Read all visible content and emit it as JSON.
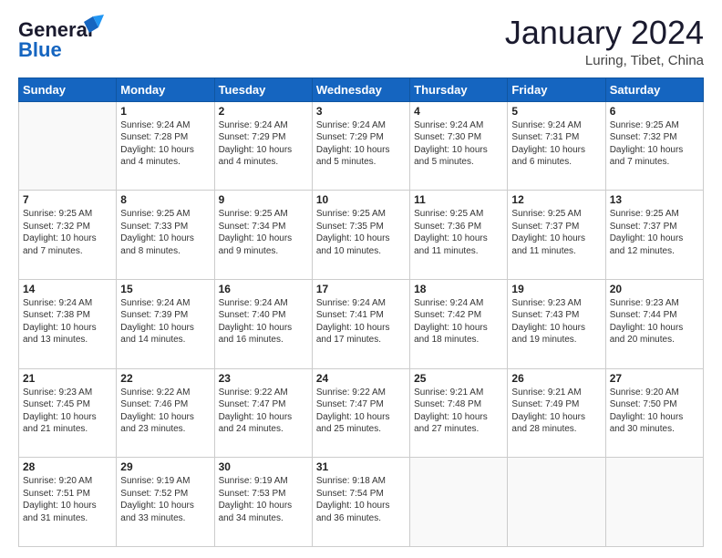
{
  "header": {
    "logo_line1": "General",
    "logo_line2": "Blue",
    "month_year": "January 2024",
    "location": "Luring, Tibet, China"
  },
  "days_of_week": [
    "Sunday",
    "Monday",
    "Tuesday",
    "Wednesday",
    "Thursday",
    "Friday",
    "Saturday"
  ],
  "weeks": [
    [
      {
        "day": "",
        "content": ""
      },
      {
        "day": "1",
        "content": "Sunrise: 9:24 AM\nSunset: 7:28 PM\nDaylight: 10 hours\nand 4 minutes."
      },
      {
        "day": "2",
        "content": "Sunrise: 9:24 AM\nSunset: 7:29 PM\nDaylight: 10 hours\nand 4 minutes."
      },
      {
        "day": "3",
        "content": "Sunrise: 9:24 AM\nSunset: 7:29 PM\nDaylight: 10 hours\nand 5 minutes."
      },
      {
        "day": "4",
        "content": "Sunrise: 9:24 AM\nSunset: 7:30 PM\nDaylight: 10 hours\nand 5 minutes."
      },
      {
        "day": "5",
        "content": "Sunrise: 9:24 AM\nSunset: 7:31 PM\nDaylight: 10 hours\nand 6 minutes."
      },
      {
        "day": "6",
        "content": "Sunrise: 9:25 AM\nSunset: 7:32 PM\nDaylight: 10 hours\nand 7 minutes."
      }
    ],
    [
      {
        "day": "7",
        "content": "Sunrise: 9:25 AM\nSunset: 7:32 PM\nDaylight: 10 hours\nand 7 minutes."
      },
      {
        "day": "8",
        "content": "Sunrise: 9:25 AM\nSunset: 7:33 PM\nDaylight: 10 hours\nand 8 minutes."
      },
      {
        "day": "9",
        "content": "Sunrise: 9:25 AM\nSunset: 7:34 PM\nDaylight: 10 hours\nand 9 minutes."
      },
      {
        "day": "10",
        "content": "Sunrise: 9:25 AM\nSunset: 7:35 PM\nDaylight: 10 hours\nand 10 minutes."
      },
      {
        "day": "11",
        "content": "Sunrise: 9:25 AM\nSunset: 7:36 PM\nDaylight: 10 hours\nand 11 minutes."
      },
      {
        "day": "12",
        "content": "Sunrise: 9:25 AM\nSunset: 7:37 PM\nDaylight: 10 hours\nand 11 minutes."
      },
      {
        "day": "13",
        "content": "Sunrise: 9:25 AM\nSunset: 7:37 PM\nDaylight: 10 hours\nand 12 minutes."
      }
    ],
    [
      {
        "day": "14",
        "content": "Sunrise: 9:24 AM\nSunset: 7:38 PM\nDaylight: 10 hours\nand 13 minutes."
      },
      {
        "day": "15",
        "content": "Sunrise: 9:24 AM\nSunset: 7:39 PM\nDaylight: 10 hours\nand 14 minutes."
      },
      {
        "day": "16",
        "content": "Sunrise: 9:24 AM\nSunset: 7:40 PM\nDaylight: 10 hours\nand 16 minutes."
      },
      {
        "day": "17",
        "content": "Sunrise: 9:24 AM\nSunset: 7:41 PM\nDaylight: 10 hours\nand 17 minutes."
      },
      {
        "day": "18",
        "content": "Sunrise: 9:24 AM\nSunset: 7:42 PM\nDaylight: 10 hours\nand 18 minutes."
      },
      {
        "day": "19",
        "content": "Sunrise: 9:23 AM\nSunset: 7:43 PM\nDaylight: 10 hours\nand 19 minutes."
      },
      {
        "day": "20",
        "content": "Sunrise: 9:23 AM\nSunset: 7:44 PM\nDaylight: 10 hours\nand 20 minutes."
      }
    ],
    [
      {
        "day": "21",
        "content": "Sunrise: 9:23 AM\nSunset: 7:45 PM\nDaylight: 10 hours\nand 21 minutes."
      },
      {
        "day": "22",
        "content": "Sunrise: 9:22 AM\nSunset: 7:46 PM\nDaylight: 10 hours\nand 23 minutes."
      },
      {
        "day": "23",
        "content": "Sunrise: 9:22 AM\nSunset: 7:47 PM\nDaylight: 10 hours\nand 24 minutes."
      },
      {
        "day": "24",
        "content": "Sunrise: 9:22 AM\nSunset: 7:47 PM\nDaylight: 10 hours\nand 25 minutes."
      },
      {
        "day": "25",
        "content": "Sunrise: 9:21 AM\nSunset: 7:48 PM\nDaylight: 10 hours\nand 27 minutes."
      },
      {
        "day": "26",
        "content": "Sunrise: 9:21 AM\nSunset: 7:49 PM\nDaylight: 10 hours\nand 28 minutes."
      },
      {
        "day": "27",
        "content": "Sunrise: 9:20 AM\nSunset: 7:50 PM\nDaylight: 10 hours\nand 30 minutes."
      }
    ],
    [
      {
        "day": "28",
        "content": "Sunrise: 9:20 AM\nSunset: 7:51 PM\nDaylight: 10 hours\nand 31 minutes."
      },
      {
        "day": "29",
        "content": "Sunrise: 9:19 AM\nSunset: 7:52 PM\nDaylight: 10 hours\nand 33 minutes."
      },
      {
        "day": "30",
        "content": "Sunrise: 9:19 AM\nSunset: 7:53 PM\nDaylight: 10 hours\nand 34 minutes."
      },
      {
        "day": "31",
        "content": "Sunrise: 9:18 AM\nSunset: 7:54 PM\nDaylight: 10 hours\nand 36 minutes."
      },
      {
        "day": "",
        "content": ""
      },
      {
        "day": "",
        "content": ""
      },
      {
        "day": "",
        "content": ""
      }
    ]
  ]
}
